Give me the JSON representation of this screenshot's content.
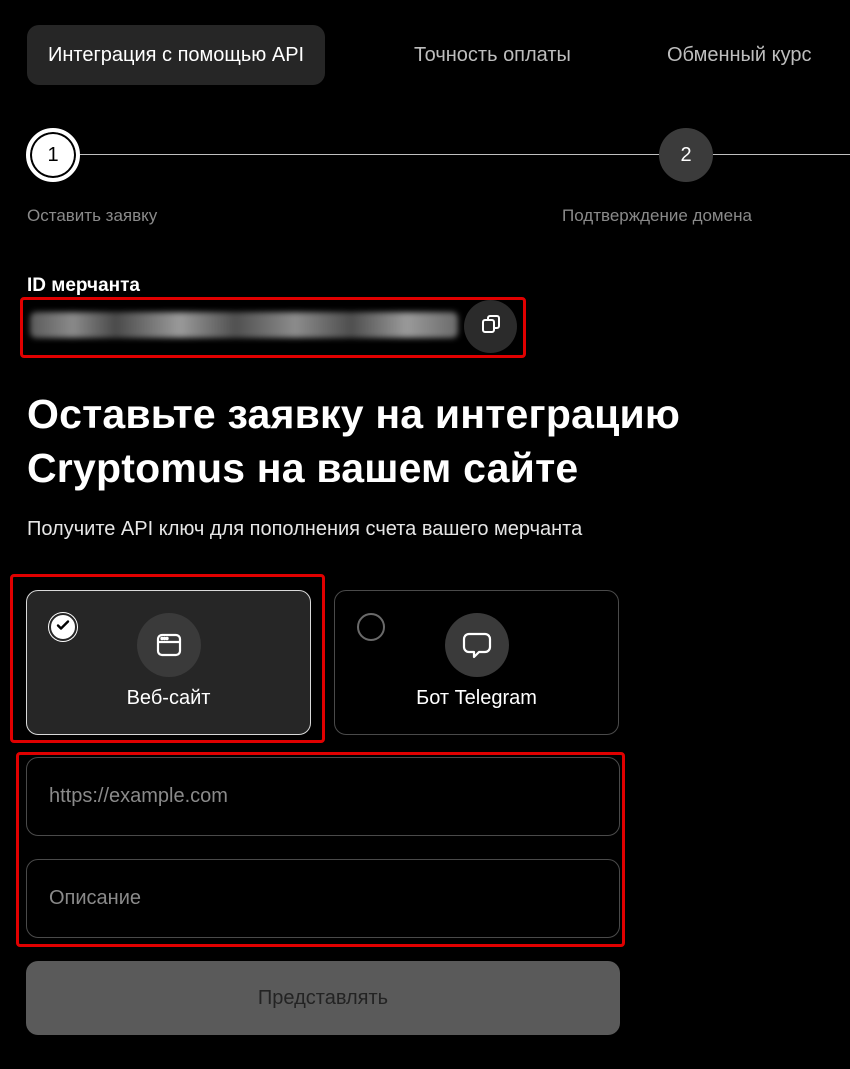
{
  "tabs": [
    {
      "label": "Интеграция с помощью API",
      "active": true
    },
    {
      "label": "Точность оплаты",
      "active": false
    },
    {
      "label": "Обменный курс",
      "active": false
    }
  ],
  "stepper": {
    "steps": [
      {
        "number": "1",
        "label": "Оставить заявку",
        "state": "active"
      },
      {
        "number": "2",
        "label": "Подтверждение домена",
        "state": "pending"
      }
    ]
  },
  "merchant": {
    "label": "ID мерчанта",
    "copy_icon": "copy-icon"
  },
  "heading": {
    "title": "Оставьте заявку на интеграцию Cryptomus на вашем сайте",
    "subtitle": "Получите API ключ для пополнения счета вашего мерчанта"
  },
  "options": [
    {
      "label": "Веб-сайт",
      "icon": "browser-window-icon",
      "selected": true
    },
    {
      "label": "Бот Telegram",
      "icon": "chat-bubble-icon",
      "selected": false
    }
  ],
  "form": {
    "url_placeholder": "https://example.com",
    "url_value": "",
    "description_placeholder": "Описание",
    "description_value": "",
    "submit_label": "Представлять"
  },
  "colors": {
    "background": "#000000",
    "card_selected": "#262626",
    "highlight": "#e00000",
    "submit_disabled": "#5a5a5a"
  }
}
